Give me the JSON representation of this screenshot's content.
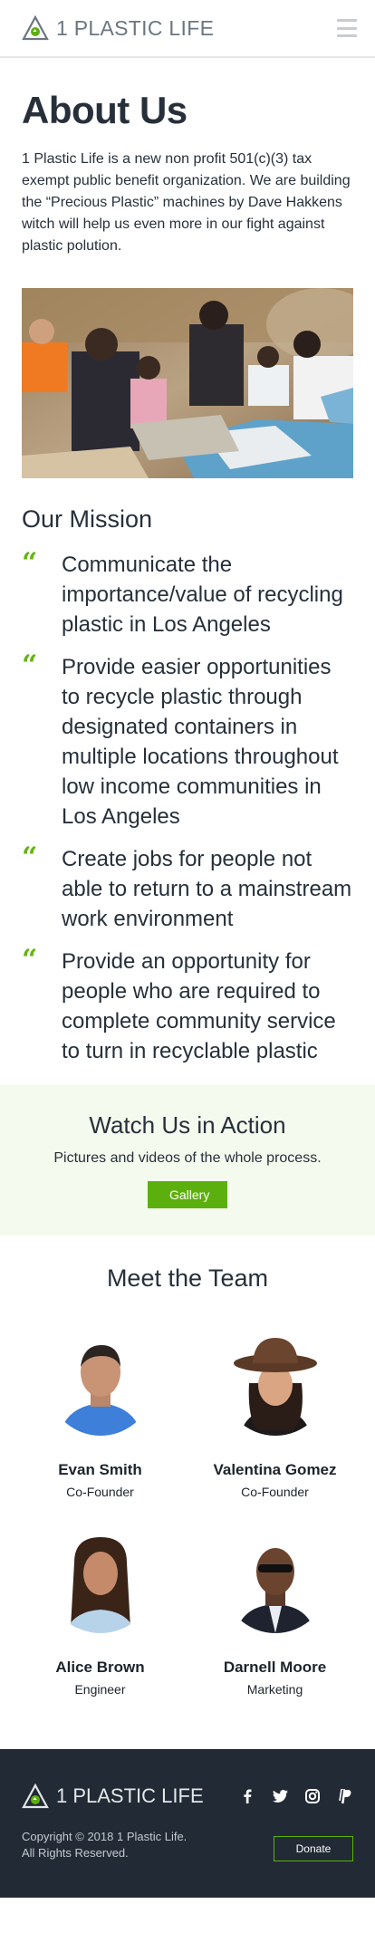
{
  "header": {
    "logo_text": "1 PLASTIC LIFE",
    "menu_icon": "hamburger-menu-icon"
  },
  "about": {
    "title": "About Us",
    "body": "1 Plastic Life is a new non profit 501(c)(3) tax exempt public benefit organization. We are building the “Precious Plastic” machines by Dave Hakkens witch will help us even more in our fight against plastic polution."
  },
  "mission": {
    "title": "Our Mission",
    "quote_glyph": "“",
    "items": [
      "Communicate the importance/value of recycling plastic in Los Angeles",
      "Provide easier opportunities to recycle plastic through designated containers in multiple locations throughout low income communities in Los Angeles",
      "Create jobs for people not able to return to a mainstream work environment",
      "Provide an opportunity for people who are required to complete community service to turn in recyclable plastic"
    ]
  },
  "action": {
    "title": "Watch Us in Action",
    "subtitle": "Pictures and videos of the whole process.",
    "button": "Gallery"
  },
  "team": {
    "title": "Meet the Team",
    "members": [
      {
        "name": "Evan Smith",
        "role": "Co-Founder"
      },
      {
        "name": "Valentina Gomez",
        "role": "Co-Founder"
      },
      {
        "name": "Alice Brown",
        "role": "Engineer"
      },
      {
        "name": "Darnell Moore",
        "role": "Marketing"
      }
    ]
  },
  "footer": {
    "logo_text": "1 PLASTIC LIFE",
    "copyright_line1": "Copyright © 2018 1 Plastic Life.",
    "copyright_line2": "All Rights Reserved.",
    "donate": "Donate",
    "socials": [
      "facebook-icon",
      "twitter-icon",
      "instagram-icon",
      "paypal-icon"
    ]
  },
  "colors": {
    "accent": "#5cb00d",
    "text": "#27303a",
    "footer_bg": "#222a35",
    "action_bg": "#f5faee"
  }
}
